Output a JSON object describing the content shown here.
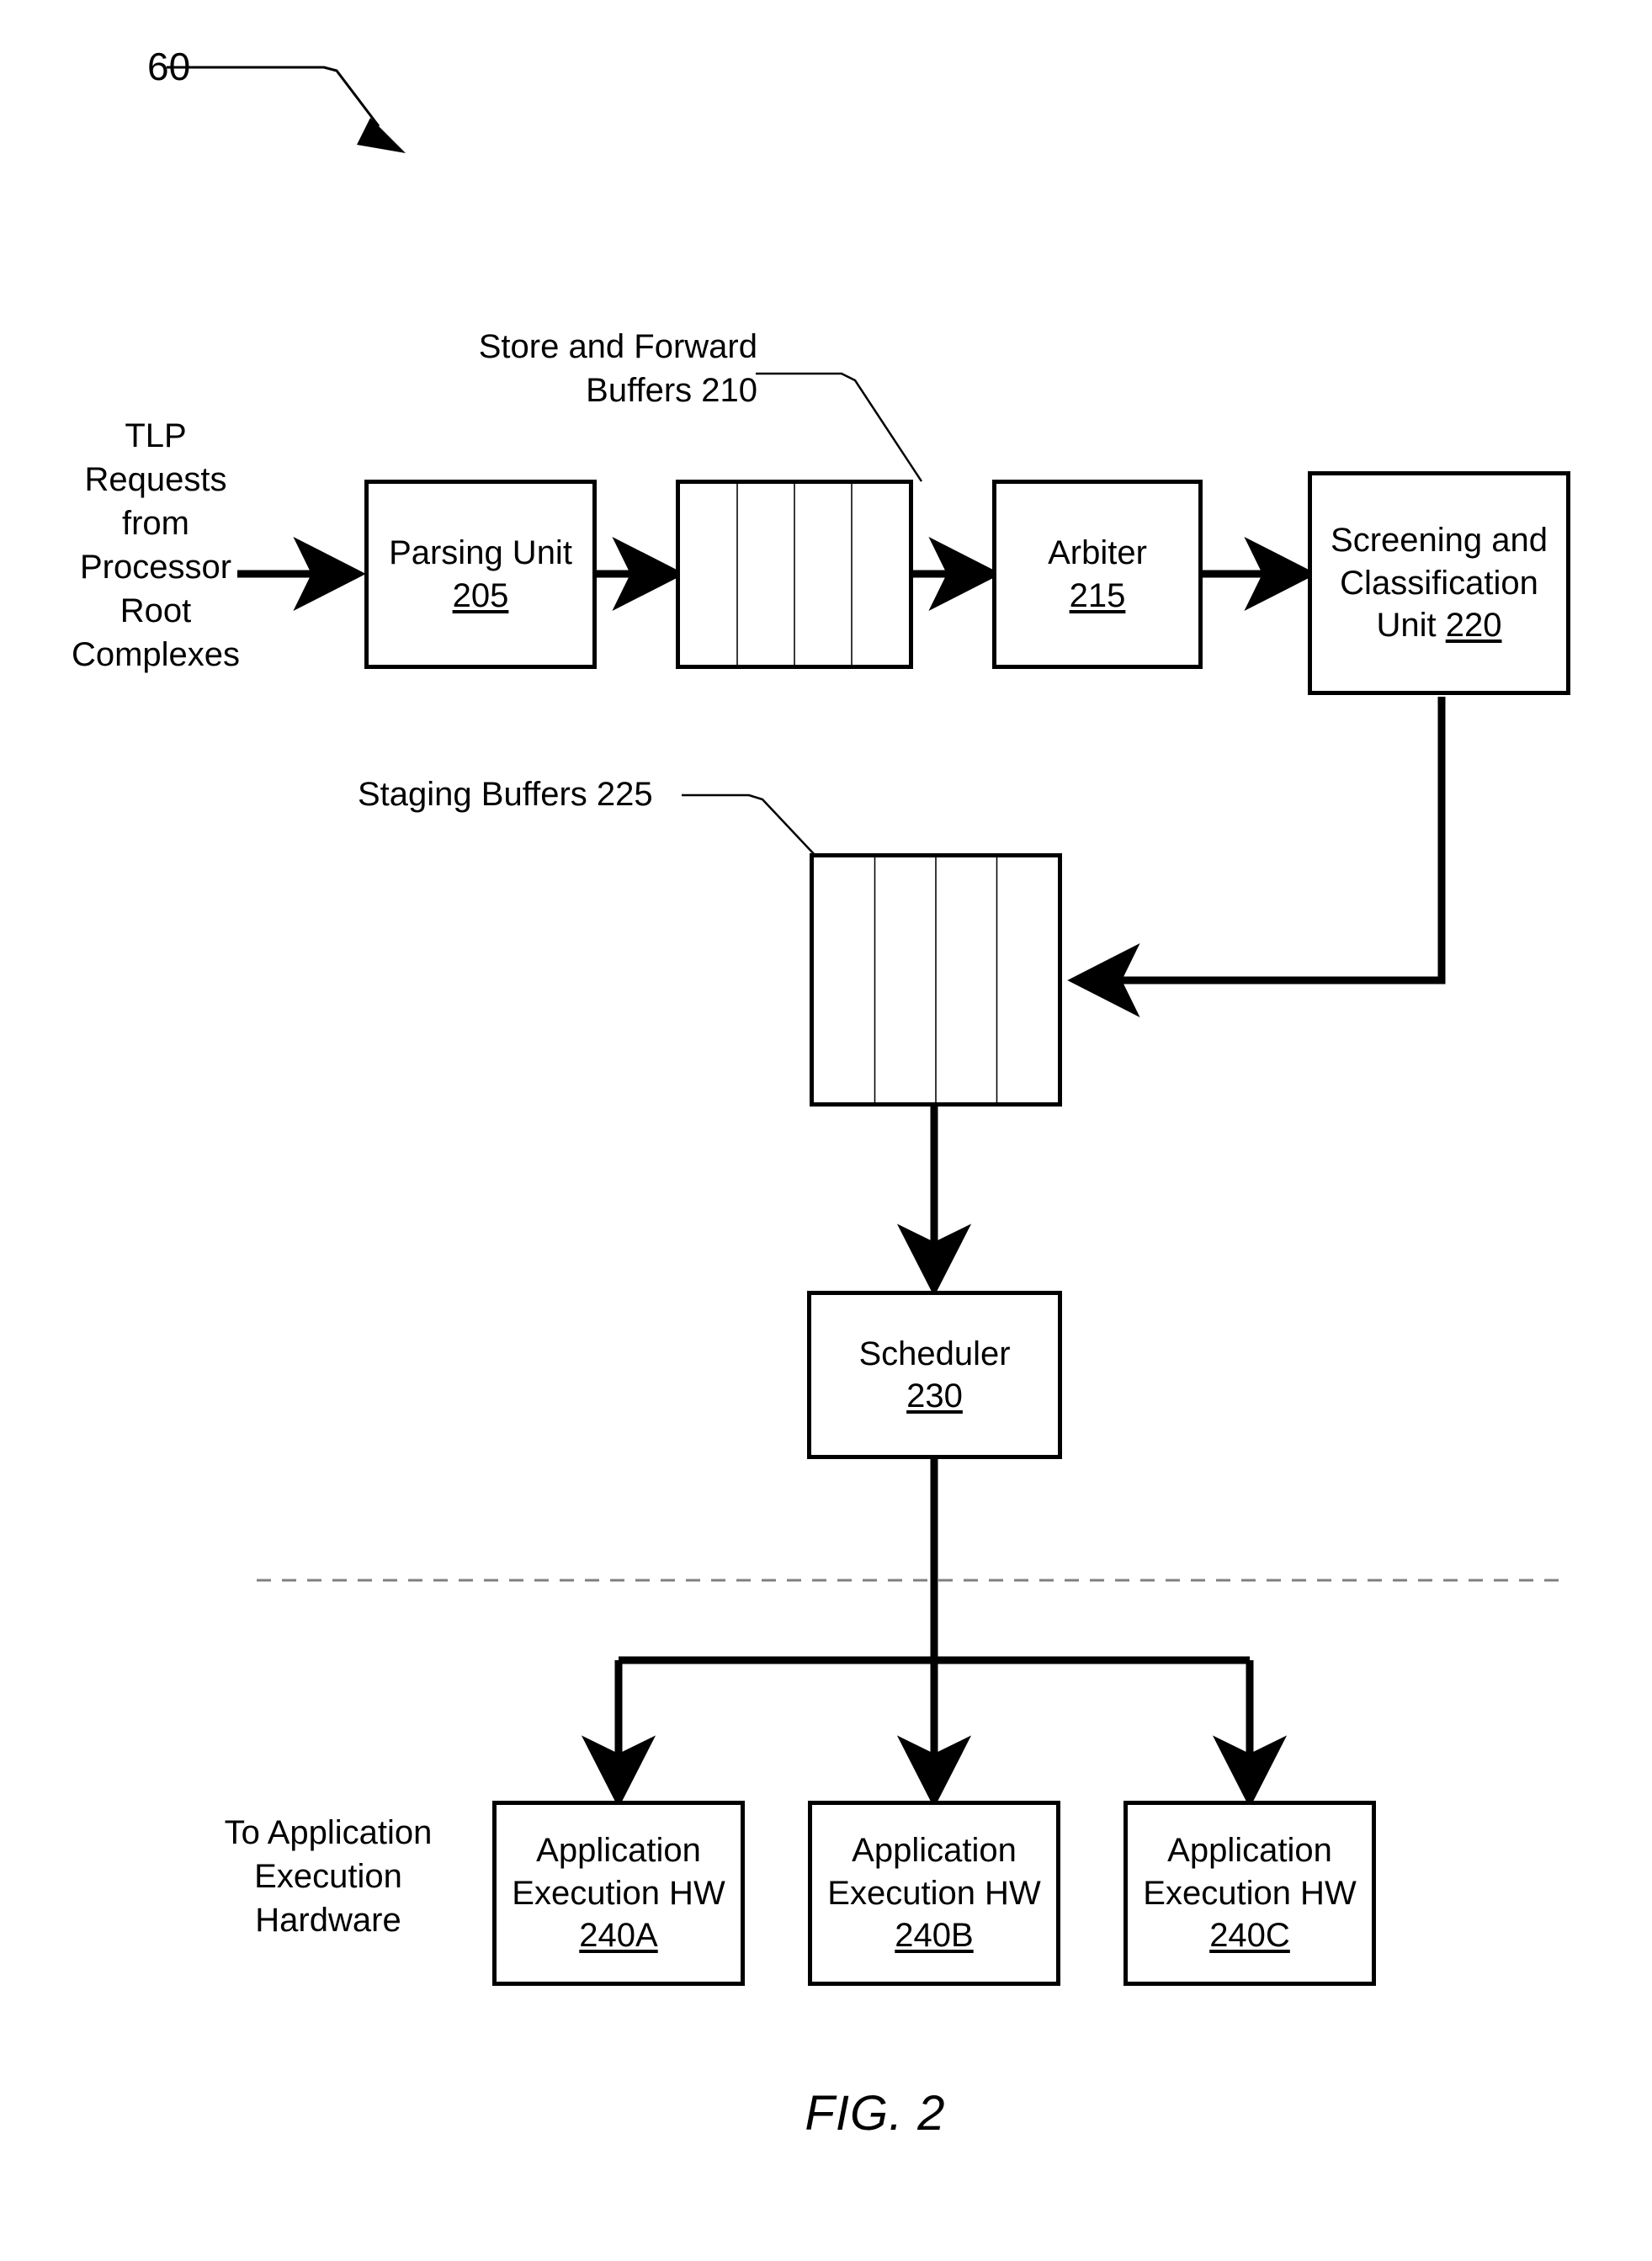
{
  "figure": {
    "number_callout": "60",
    "caption": "FIG. 2"
  },
  "labels": {
    "input_source": "TLP\nRequests\nfrom\nProcessor\nRoot\nComplexes",
    "store_forward_buffers": "Store and Forward\nBuffers 210",
    "staging_buffers": "Staging Buffers 225",
    "to_app_hw": "To Application\nExecution\nHardware"
  },
  "blocks": {
    "parsing_unit": {
      "title": "Parsing Unit",
      "ref": "205"
    },
    "store_forward_buffers": {
      "title": "",
      "ref": "210",
      "cells": 4
    },
    "arbiter": {
      "title": "Arbiter",
      "ref": "215"
    },
    "screening_unit": {
      "line1": "Screening and",
      "line2": "Classification",
      "line3_prefix": "Unit ",
      "ref": "220"
    },
    "staging_buffers": {
      "title": "",
      "ref": "225",
      "cells": 4
    },
    "scheduler": {
      "title": "Scheduler",
      "ref": "230"
    },
    "app_hw_a": {
      "line1": "Application",
      "line2": "Execution HW",
      "ref": "240A"
    },
    "app_hw_b": {
      "line1": "Application",
      "line2": "Execution HW",
      "ref": "240B"
    },
    "app_hw_c": {
      "line1": "Application",
      "line2": "Execution HW",
      "ref": "240C"
    }
  },
  "colors": {
    "stroke": "#000000",
    "background": "#ffffff",
    "divider": "#808080"
  }
}
